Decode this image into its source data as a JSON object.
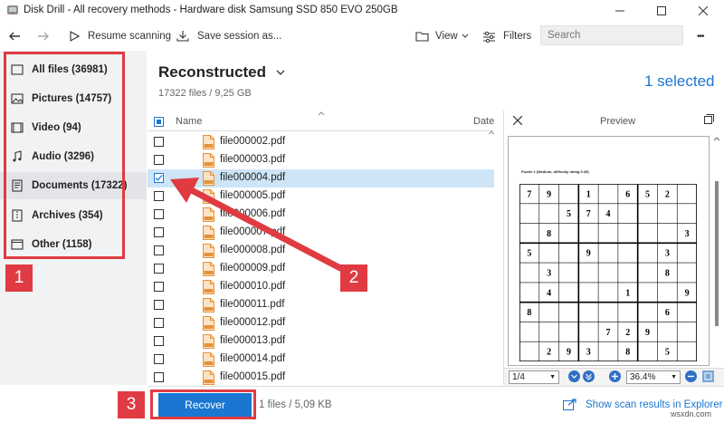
{
  "window": {
    "title": "Disk Drill - All recovery methods - Hardware disk Samsung SSD 850 EVO 250GB",
    "minimize": "—",
    "maximize": "☐",
    "close": "✕"
  },
  "toolbar": {
    "resume_label": "Resume scanning",
    "save_label": "Save session as...",
    "view_label": "View",
    "filters_label": "Filters",
    "search_placeholder": "Search",
    "more_label": "•••"
  },
  "sidebar": {
    "items": [
      {
        "label": "All files (36981)",
        "icon": "all-files-icon"
      },
      {
        "label": "Pictures (14757)",
        "icon": "picture-icon"
      },
      {
        "label": "Video (94)",
        "icon": "video-icon"
      },
      {
        "label": "Audio (3296)",
        "icon": "audio-icon"
      },
      {
        "label": "Documents (17322)",
        "icon": "document-icon",
        "active": true
      },
      {
        "label": "Archives (354)",
        "icon": "archive-icon"
      },
      {
        "label": "Other (1158)",
        "icon": "other-icon"
      }
    ]
  },
  "main": {
    "title": "Reconstructed",
    "subtitle": "17322 files / 9,25 GB",
    "selected": "1 selected",
    "columns": {
      "name": "Name",
      "date": "Date"
    },
    "files": [
      {
        "name": "file000002.pdf",
        "checked": false
      },
      {
        "name": "file000003.pdf",
        "checked": false
      },
      {
        "name": "file000004.pdf",
        "checked": true
      },
      {
        "name": "file000005.pdf",
        "checked": false
      },
      {
        "name": "file000006.pdf",
        "checked": false
      },
      {
        "name": "file000007.pdf",
        "checked": false
      },
      {
        "name": "file000008.pdf",
        "checked": false
      },
      {
        "name": "file000009.pdf",
        "checked": false
      },
      {
        "name": "file000010.pdf",
        "checked": false
      },
      {
        "name": "file000011.pdf",
        "checked": false
      },
      {
        "name": "file000012.pdf",
        "checked": false
      },
      {
        "name": "file000013.pdf",
        "checked": false
      },
      {
        "name": "file000014.pdf",
        "checked": false
      },
      {
        "name": "file000015.pdf",
        "checked": false
      }
    ]
  },
  "preview": {
    "title": "Preview",
    "doc_heading": "Puzzle 1 (Medium, difficulty rating 0.49)",
    "grid": [
      [
        "7",
        "9",
        "",
        "1",
        "",
        "6",
        "5",
        "2",
        ""
      ],
      [
        "",
        "",
        "5",
        "7",
        "4",
        "",
        "",
        "",
        ""
      ],
      [
        "",
        "8",
        "",
        "",
        "",
        "",
        "",
        "",
        "3"
      ],
      [
        "5",
        "",
        "",
        "9",
        "",
        "",
        "",
        "3",
        ""
      ],
      [
        "",
        "3",
        "",
        "",
        "",
        "",
        "",
        "8",
        ""
      ],
      [
        "",
        "4",
        "",
        "",
        "",
        "1",
        "",
        "",
        "9"
      ],
      [
        "8",
        "",
        "",
        "",
        "",
        "",
        "",
        "6",
        ""
      ],
      [
        "",
        "",
        "",
        "",
        "7",
        "2",
        "9",
        "",
        ""
      ],
      [
        "",
        "2",
        "9",
        "3",
        "",
        "8",
        "",
        "5",
        ""
      ]
    ],
    "page": "1/4",
    "zoom": "36.4%"
  },
  "bottom": {
    "recover_label": "Recover",
    "info": "1 files / 5,09 KB",
    "show_results": "Show scan results in Explorer"
  },
  "annotations": {
    "c1": "1",
    "c2": "2",
    "c3": "3",
    "color": "#e03b42"
  },
  "watermark": "wsxdn.com"
}
